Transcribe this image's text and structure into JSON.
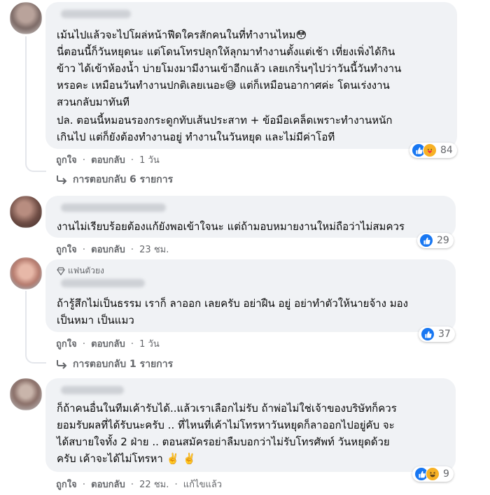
{
  "comments": [
    {
      "lines": [
        "เม้นไปแล้วจะไปโผล่หน้าฟีดใครสักคนในที่ทำงานไหม😳",
        "นี่ตอนนี้ก็วันหยุดนะ แต่โดนโทรปลุกให้ลุกมาทำงานตั้งแต่เช้า เที่ยงเพิ่งได้กิน",
        "ข้าว ได้เข้าห้องน้ำ บ่ายโมงมามีงานเข้าอีกแล้ว เลยเกริ่นๆไปว่าวันนี้วันทำงาน",
        "หรอคะ เหมือนวันทำงานปกติเลยเนอะ😅 แต่ก็เหมือนอากาศค่ะ โดนเร่งงาน",
        "สวนกลับมาทันที",
        "ปล. ตอนนี้หมอนรองกระดูกทับเส้นประสาท + ข้อมือเคล็ดเพราะทำงานหนัก",
        "เกินไป แต่ก็ยังต้องทำงานอยู่ ทำงานในวันหยุด และไม่มีค่าโอที"
      ],
      "like_label": "ถูกใจ",
      "reply_label": "ตอบกลับ",
      "time": "1 วัน",
      "reaction_count": "84",
      "replies_label": "การตอบกลับ 6 รายการ"
    },
    {
      "lines": [
        "งานไม่เรียบร้อยต้องแก้ยังพอเข้าใจนะ แต่ถ้ามอบหมายงานใหม่ถือว่าไม่สมควร"
      ],
      "like_label": "ถูกใจ",
      "reply_label": "ตอบกลับ",
      "time": "23 ชม.",
      "reaction_count": "29"
    },
    {
      "badge": "แฟนตัวยง",
      "lines": [
        "ถ้ารู้สึกไม่เป็นธรรม เราก็ ลาออก เลยครับ อย่าฝืน อยู่ อย่าทำตัวให้นายจ้าง มอง",
        "เป็นหมา เป็นแมว"
      ],
      "like_label": "ถูกใจ",
      "reply_label": "ตอบกลับ",
      "time": "1 วัน",
      "reaction_count": "37",
      "replies_label": "การตอบกลับ 1 รายการ"
    },
    {
      "lines": [
        "ก็ถ้าคนอื่นในทีมเค้ารับได้..แล้วเราเลือกไม่รับ ถ้าพ่อไม่ใช่เจ้าของบริษัทก็ควร",
        "ยอมรับผลที่ได้รับนะครับ .. ที่ไหนที่เค้าไม่โทรหาวันหยุดก็ลาออกไปอยู่คับ จะ",
        "ได้สบายใจทั้ง 2 ฝ่าย .. ตอนสมัครอย่าลืมบอกว่าไม่รับโทรศัพท์ วันหยุดด้วย",
        "ครับ เค้าจะได้ไม่โทรหา ✌️ ✌️"
      ],
      "like_label": "ถูกใจ",
      "reply_label": "ตอบกลับ",
      "time": "22 ชม.",
      "edited_label": "แก้ไขแล้ว",
      "reaction_count": "9"
    }
  ],
  "colors": {
    "bubble": "#f0f2f5",
    "secondary_text": "#65676b",
    "like_blue": "#1877f2",
    "emoji_yellow": "#f7b125"
  },
  "icons": [
    "like-icon",
    "care-icon",
    "haha-icon",
    "reply-arrow-icon",
    "diamond-icon"
  ]
}
